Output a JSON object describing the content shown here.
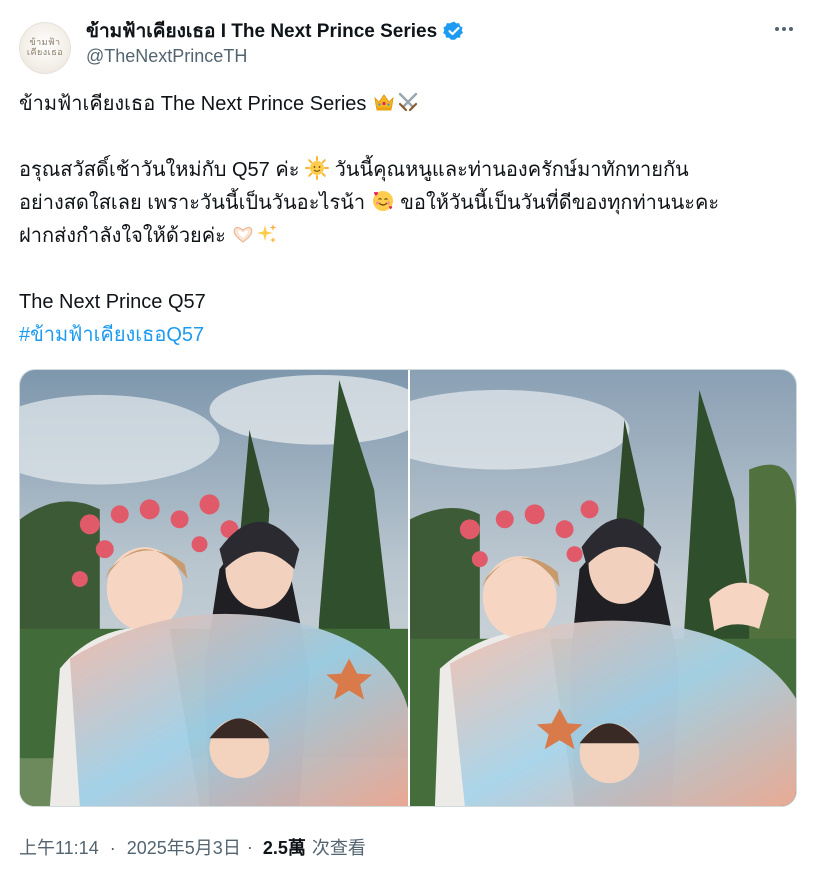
{
  "account": {
    "display_name": "ข้ามฟ้าเคียงเธอ I The Next Prince Series",
    "handle": "@TheNextPrinceTH",
    "verified": true,
    "avatar_logo_line1": "ข้ามฟ้า",
    "avatar_logo_line2": "เคียงเธอ"
  },
  "tweet": {
    "line1": "ข้ามฟ้าเคียงเธอ The Next Prince Series ",
    "line2": "อรุณสวัสดิ์เช้าวันใหม่กับ Q57 ค่ะ ",
    "line2b": " วันนี้คุณหนูและท่านองครักษ์มาทักทายกัน",
    "line3": "อย่างสดใสเลย เพราะวันนี้เป็นวันอะไรน้า ",
    "line3b": " ขอให้วันนี้เป็นวันที่ดีของทุกท่านนะคะ",
    "line4": "ฝากส่งกำลังใจให้ด้วยค่ะ ",
    "line5": "The Next Prince Q57",
    "hashtag": "#ข้ามฟ้าเคียงเธอQ57"
  },
  "icons": {
    "crown": "crown-emoji",
    "swords": "crossed-swords-emoji",
    "sun": "sun-with-face-emoji",
    "smiling_hearts": "smiling-face-with-hearts-emoji",
    "heart_hands": "heart-hands-emoji",
    "sparkles": "sparkles-emoji",
    "more": "more-options-icon",
    "verified": "verified-badge-icon"
  },
  "meta": {
    "time": "上午11:14",
    "separator": "·",
    "date": "2025年5月3日",
    "views_count": "2.5萬",
    "views_label": "次查看"
  },
  "colors": {
    "link": "#1d9bf0",
    "secondary_text": "#536471",
    "primary_text": "#0f1419",
    "verified": "#1d9bf0"
  }
}
